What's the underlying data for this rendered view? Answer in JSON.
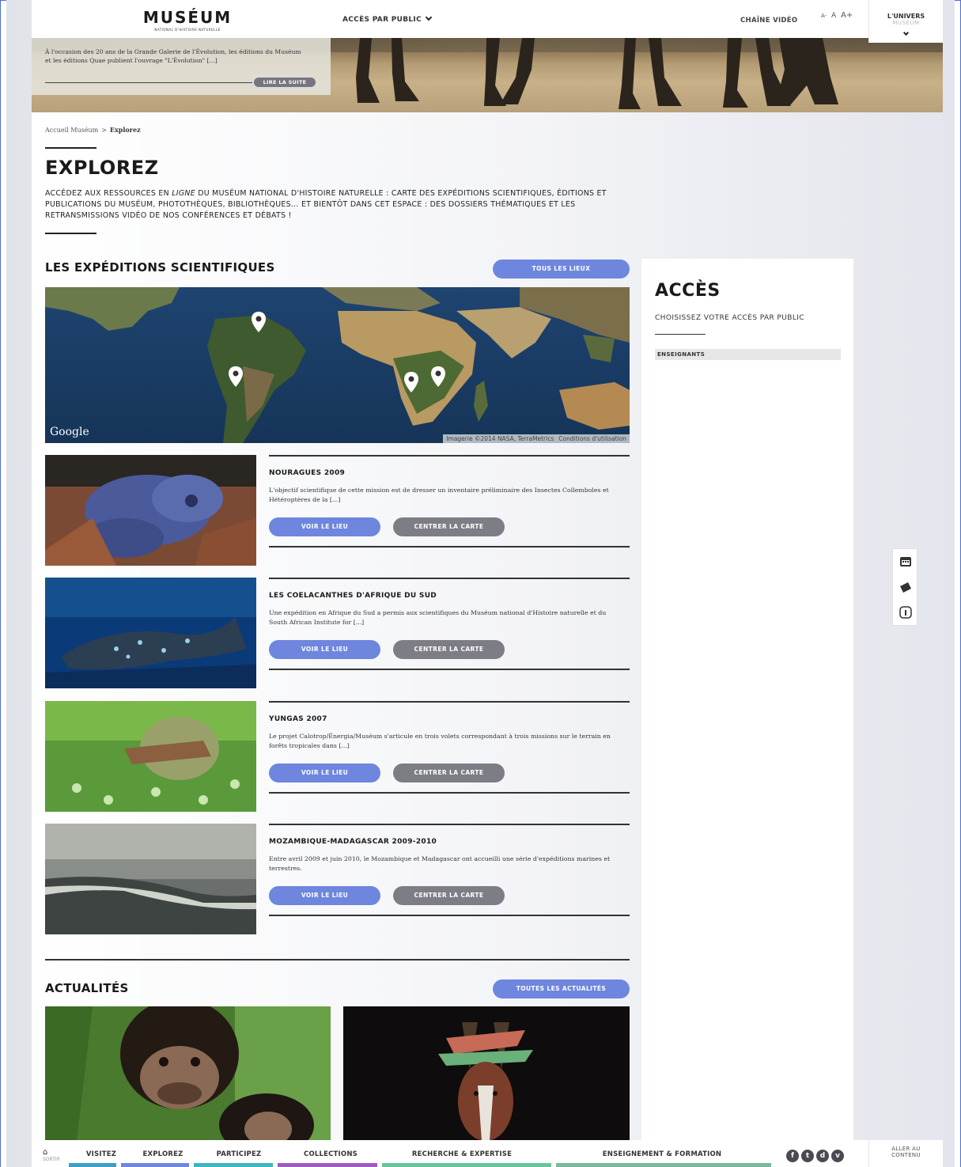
{
  "header": {
    "logo": "MUSÉUM",
    "logo_sub": "NATIONAL D'HISTOIRE NATURELLE",
    "acces_public": "ACCÈS PAR PUBLIC",
    "chaine_video": "CHAÎNE VIDÉO",
    "font_sizes": [
      "A-",
      "A",
      "A+"
    ],
    "univers_title": "L'UNIVERS",
    "univers_sub": "MUSÉUM"
  },
  "banner": {
    "teaser_text": "À l'occasion des 20 ans de la Grande Galerie de l'Évolution, les éditions du Muséum et les éditions Quae publient l'ouvrage \"L'Évolution\" [...]",
    "read_more": "LIRE LA SUITE"
  },
  "breadcrumb": {
    "home": "Accueil Muséum",
    "sep": ">",
    "current": "Explorez"
  },
  "page": {
    "title": "EXPLOREZ",
    "intro_a": "ACCÉDEZ AUX RESSOURCES EN ",
    "intro_em": "LIGNE",
    "intro_b": " DU MUSÉUM NATIONAL D'HISTOIRE NATURELLE : CARTE DES EXPÉDITIONS SCIENTIFIQUES, ÉDITIONS ET PUBLICATIONS DU MUSÉUM, PHOTOTHÈQUES, BIBLIOTHÈQUES... ET BIENTÔT DANS CET ESPACE : DES DOSSIERS THÉMATIQUES ET LES RETRANSMISSIONS VIDÉO DE NOS CONFÉRENCES ET DÉBATS !"
  },
  "expeditions": {
    "title": "LES EXPÉDITIONS SCIENTIFIQUES",
    "all_button": "TOUS LES LIEUX",
    "map": {
      "google": "Google",
      "imagery": "Imagerie ©2014 NASA, TerraMetrics",
      "terms": "Conditions d'utilisation"
    },
    "items": [
      {
        "title": "NOURAGUES 2009",
        "desc": "L'objectif scientifique de cette mission est de dresser un inventaire préliminaire des Insectes Collemboles et Hétéroptères de la [...]",
        "view": "VOIR LE LIEU",
        "center": "CENTRER LA CARTE"
      },
      {
        "title": "LES COELACANTHES D'AFRIQUE DU SUD",
        "desc": "Une expédition en Afrique du Sud a permis aux scientifiques du Muséum national d'Histoire naturelle et du South African Institute for [...]",
        "view": "VOIR LE LIEU",
        "center": "CENTRER LA CARTE"
      },
      {
        "title": "YUNGAS 2007",
        "desc": "Le projet Calotrop/Énergia/Muséum s'articule en trois volets correspondant à trois missions sur le terrain en forêts tropicales dans [...]",
        "view": "VOIR LE LIEU",
        "center": "CENTRER LA CARTE"
      },
      {
        "title": "MOZAMBIQUE-MADAGASCAR 2009-2010",
        "desc": "Entre avril 2009 et juin 2010, le Mozambique et Madagascar ont accueilli une série d'expéditions marines et terrestres.",
        "view": "VOIR LE LIEU",
        "center": "CENTRER LA CARTE"
      }
    ]
  },
  "sidebar": {
    "title": "ACCÈS",
    "subtitle": "CHOISISSEZ VOTRE ACCÈS PAR PUBLIC",
    "item": "ENSEIGNANTS"
  },
  "tools": [
    "calendar-icon",
    "ticket-icon",
    "info-icon"
  ],
  "actualites": {
    "title": "ACTUALITÉS",
    "all_button": "TOUTES LES ACTUALITÉS"
  },
  "bottom_nav": {
    "home_label": "SORTIR",
    "items": [
      "VISITEZ",
      "EXPLOREZ",
      "PARTICIPEZ",
      "COLLECTIONS",
      "RECHERCHE & EXPERTISE",
      "ENSEIGNEMENT & FORMATION"
    ],
    "colors": [
      "#3aa0c8",
      "#6e86de",
      "#3ab8c0",
      "#a05ac0",
      "#6ac49a",
      "#7ab8a0"
    ],
    "aller_au": "ALLER AU",
    "contenu": "CONTENU"
  },
  "colors": {
    "accent_blue": "#6e86de",
    "button_grey": "#7d7d85"
  }
}
